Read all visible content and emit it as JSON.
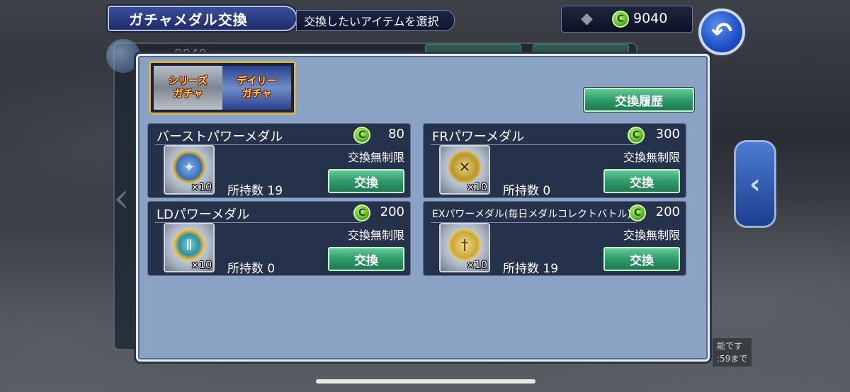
{
  "header": {
    "title": "ガチャメダル交換",
    "subtitle": "交換したいアイテムを選択",
    "currency_value": "9040",
    "gem_icon": "gem-icon",
    "back_icon": "back-arrow-icon"
  },
  "background": {
    "currency_value": "9040",
    "notice_line1": "能です",
    "notice_line2": ":59まで"
  },
  "tabs": [
    {
      "line1": "シリーズ",
      "line2": "ガチャ",
      "active": true
    },
    {
      "line1": "デイリー",
      "line2": "ガチャ",
      "active": false
    }
  ],
  "history_button": "交換履歴",
  "items": [
    {
      "name": "バーストパワーメダル",
      "cost": "80",
      "limit": "交換無制限",
      "quantity": "×10",
      "owned_label": "所持数",
      "owned": "19",
      "button": "交換",
      "medal": "burst-medal-icon"
    },
    {
      "name": "FRパワーメダル",
      "cost": "300",
      "limit": "交換無制限",
      "quantity": "×10",
      "owned_label": "所持数",
      "owned": "0",
      "button": "交換",
      "medal": "fr-medal-icon"
    },
    {
      "name": "LDパワーメダル",
      "cost": "200",
      "limit": "交換無制限",
      "quantity": "×10",
      "owned_label": "所持数",
      "owned": "0",
      "button": "交換",
      "medal": "ld-medal-icon"
    },
    {
      "name": "EXパワーメダル(毎日メダルコレクトバトル)",
      "cost": "200",
      "limit": "交換無制限",
      "quantity": "×10",
      "owned_label": "所持数",
      "owned": "19",
      "button": "交換",
      "medal": "ex-medal-icon"
    }
  ],
  "coin_symbol": "C",
  "colors": {
    "panel": "#8aa2c4",
    "card": "#26324c",
    "button_green": "#2f9b6a",
    "title_blue": "#1e2b68",
    "tab_gold": "#d4b24e"
  }
}
